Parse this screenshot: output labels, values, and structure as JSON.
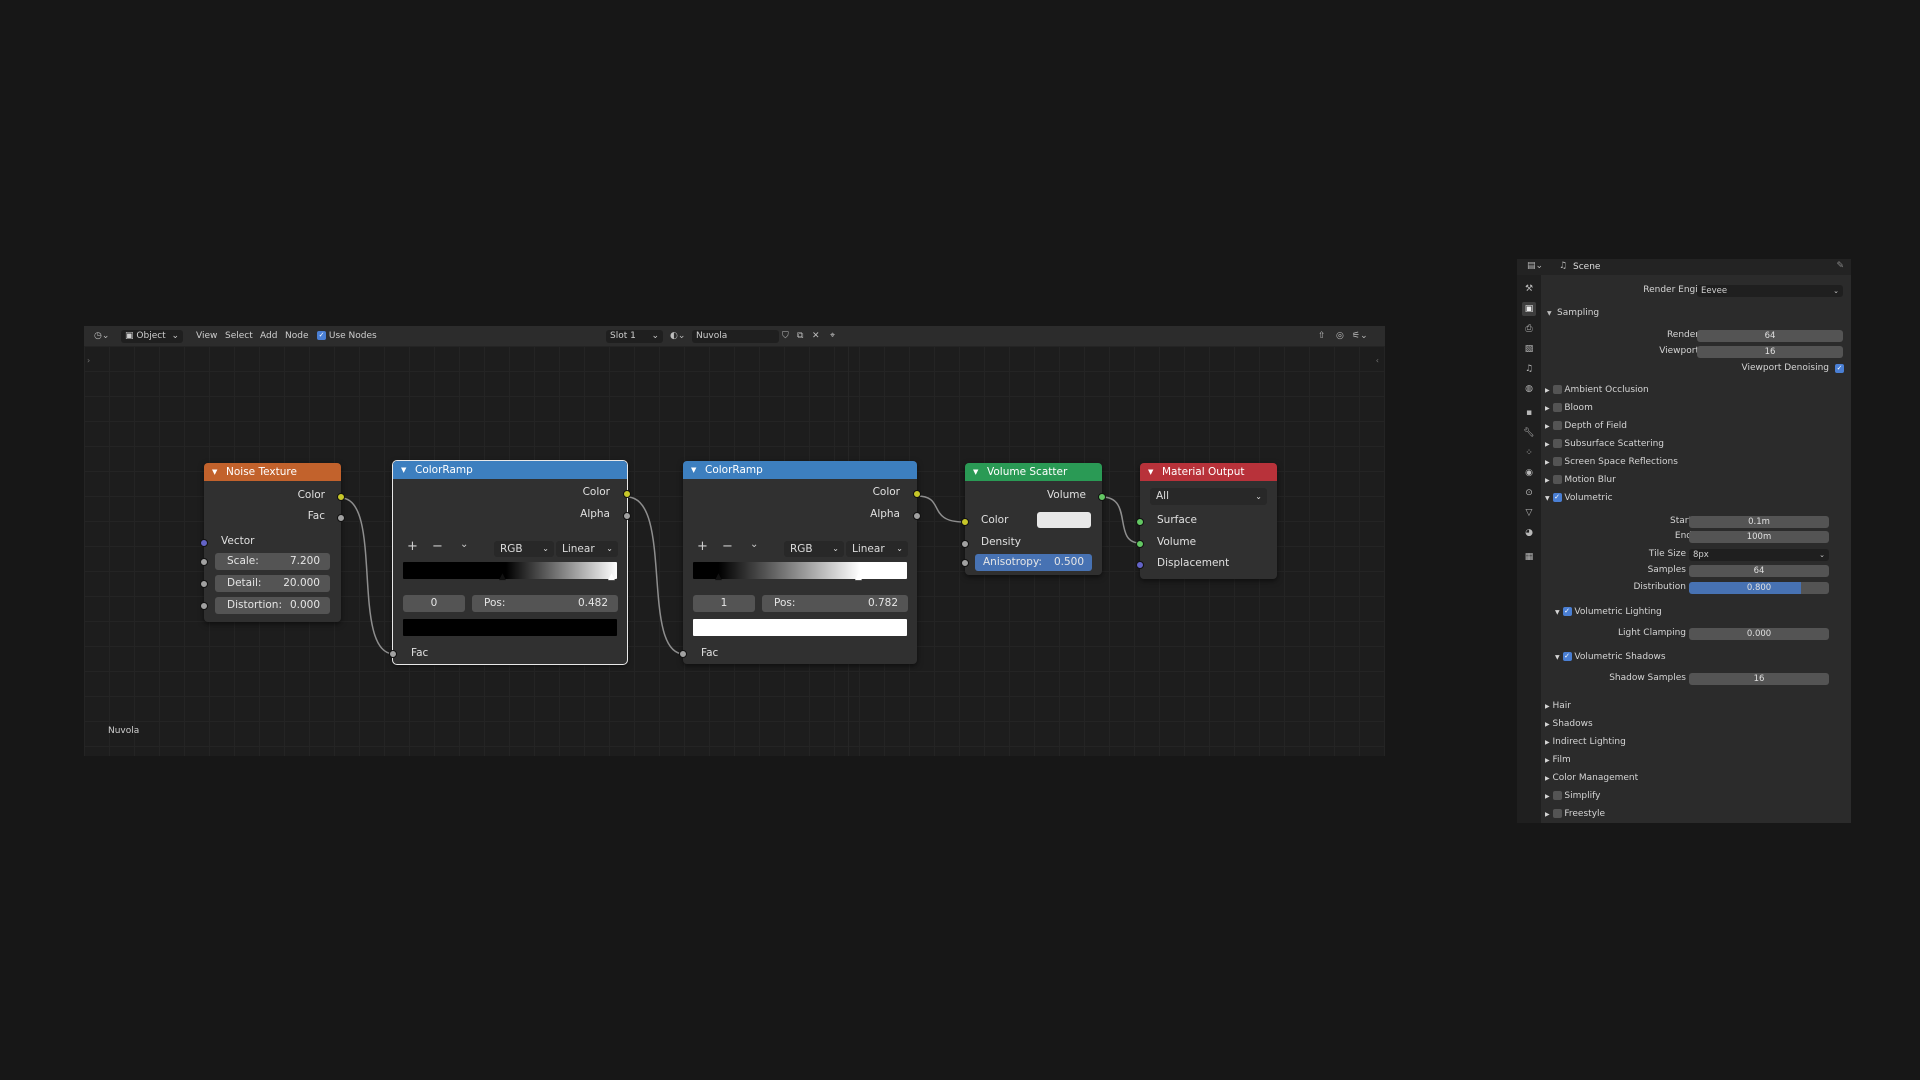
{
  "editor": {
    "header": {
      "mode": "Object",
      "menus": [
        "View",
        "Select",
        "Add",
        "Node"
      ],
      "use_nodes": "Use Nodes",
      "slot": "Slot 1",
      "material": "Nuvola"
    },
    "material_label": "Nuvola"
  },
  "nodes": {
    "noise": {
      "title": "Noise Texture",
      "out_color": "Color",
      "out_fac": "Fac",
      "in_vector": "Vector",
      "scale_label": "Scale:",
      "scale_value": "7.200",
      "detail_label": "Detail:",
      "detail_value": "20.000",
      "distortion_label": "Distortion:",
      "distortion_value": "0.000",
      "header_color": "#c2622c"
    },
    "ramp1": {
      "title": "ColorRamp",
      "out_color": "Color",
      "out_alpha": "Alpha",
      "mode": "RGB",
      "interp": "Linear",
      "index": "0",
      "pos_label": "Pos:",
      "pos_value": "0.482",
      "in_fac": "Fac",
      "header_color": "#3d7fbf"
    },
    "ramp2": {
      "title": "ColorRamp",
      "out_color": "Color",
      "out_alpha": "Alpha",
      "mode": "RGB",
      "interp": "Linear",
      "index": "1",
      "pos_label": "Pos:",
      "pos_value": "0.782",
      "in_fac": "Fac",
      "header_color": "#3d7fbf"
    },
    "scatter": {
      "title": "Volume Scatter",
      "out_volume": "Volume",
      "in_color": "Color",
      "in_density": "Density",
      "aniso_label": "Anisotropy:",
      "aniso_value": "0.500",
      "header_color": "#2a9a55"
    },
    "output": {
      "title": "Material Output",
      "target": "All",
      "in_surface": "Surface",
      "in_volume": "Volume",
      "in_displacement": "Displacement",
      "header_color": "#b8323a"
    }
  },
  "properties": {
    "context": "Scene",
    "render_engine_label": "Render Engine",
    "render_engine": "Eevee",
    "sampling": {
      "title": "Sampling",
      "render_label": "Render",
      "render_value": "64",
      "viewport_label": "Viewport",
      "viewport_value": "16",
      "denoise_label": "Viewport Denoising"
    },
    "panels_top": [
      "Ambient Occlusion",
      "Bloom",
      "Depth of Field",
      "Subsurface Scattering",
      "Screen Space Reflections",
      "Motion Blur"
    ],
    "volumetric": {
      "title": "Volumetric",
      "start_label": "Start",
      "start_value": "0.1m",
      "end_label": "End",
      "end_value": "100m",
      "tile_label": "Tile Size",
      "tile_value": "8px",
      "samples_label": "Samples",
      "samples_value": "64",
      "distribution_label": "Distribution",
      "distribution_value": "0.800",
      "lighting_title": "Volumetric Lighting",
      "clamp_label": "Light Clamping",
      "clamp_value": "0.000",
      "shadows_title": "Volumetric Shadows",
      "shadow_samples_label": "Shadow Samples",
      "shadow_samples_value": "16"
    },
    "panels_bottom": [
      "Hair",
      "Shadows",
      "Indirect Lighting",
      "Film",
      "Color Management",
      "Simplify",
      "Freestyle"
    ]
  }
}
